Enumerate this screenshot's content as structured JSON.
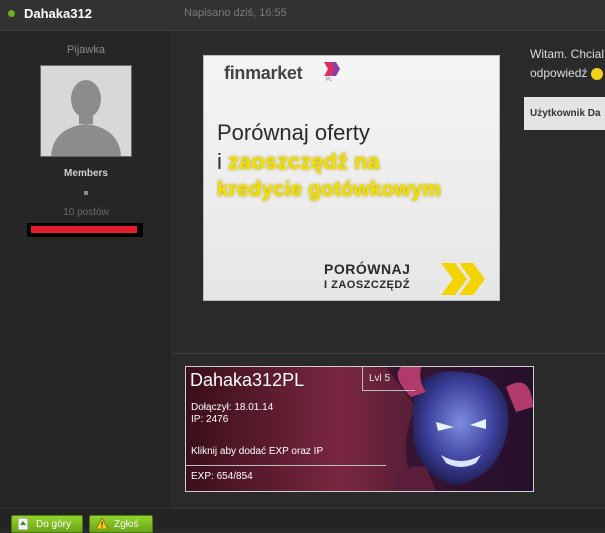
{
  "post": {
    "author": "Dahaka312",
    "date": "Napisano dziś, 16:55",
    "text_line1": "Witam. Chcial",
    "text_line2": "odpowiedź",
    "quote_text": "Użytkownik Da"
  },
  "author_panel": {
    "title": "Pijawka",
    "group": "Members",
    "post_count": "10 postów",
    "reputation_color": "#e31d2b"
  },
  "ad": {
    "logo": "finmarket",
    "logo_suffix": "PL",
    "line1": "Porównaj oferty",
    "line2_prefix": "i",
    "line2_highlight": "zaoszczędź na",
    "line3": "kredycie gotówkowym",
    "cta_line1": "PORÓWNAJ",
    "cta_line2": "I ZAOSZCZĘDŹ"
  },
  "signature": {
    "name": "Dahaka312PL",
    "level": "Lvl 5",
    "joined": "Dołączył: 18.01.14",
    "ip": "IP: 2476",
    "action": "Kliknij aby dodać EXP oraz IP",
    "exp": "EXP: 654/854"
  },
  "buttons": {
    "up_label": "Do góry",
    "report_label": "Zgłoś"
  },
  "colors": {
    "online": "#6fb01e",
    "ad_highlight": "#f2de00",
    "button_green": "#7fbf22"
  }
}
